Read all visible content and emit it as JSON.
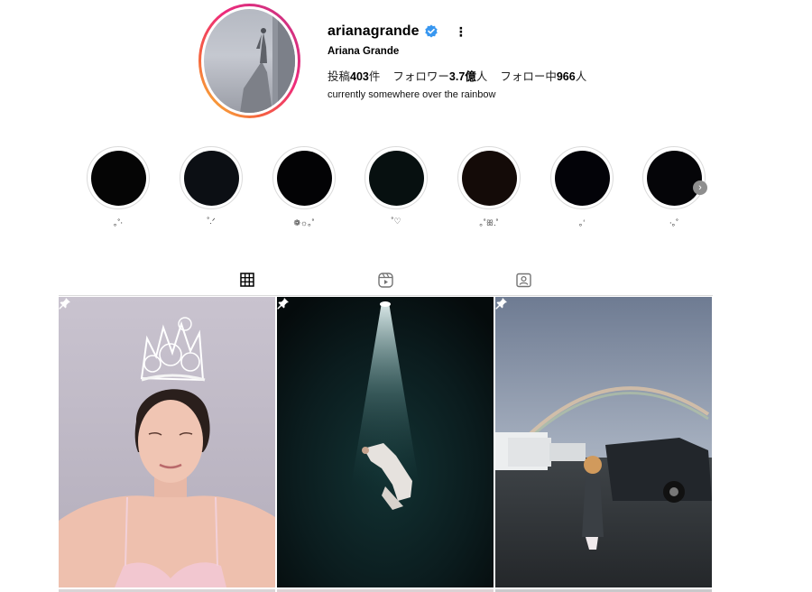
{
  "profile": {
    "username": "arianagrande",
    "full_name": "Ariana Grande",
    "more_label": "⋮",
    "stats": {
      "posts_label": "投稿",
      "posts_value": "403",
      "posts_unit": "件",
      "followers_label": "フォロワー",
      "followers_value": "3.7億",
      "followers_unit": "人",
      "following_label": "フォロー中",
      "following_value": "966",
      "following_unit": "人"
    },
    "bio": "currently somewhere over the rainbow"
  },
  "highlights": [
    {
      "label": "｡˚‧",
      "color": "#050505"
    },
    {
      "label": "˚.ᐟ",
      "color": "#0c0f14"
    },
    {
      "label": "❁☼｡˚",
      "color": "#030305"
    },
    {
      "label": "˚♡",
      "color": "#071010"
    },
    {
      "label": "｡˚ꕥ.˚",
      "color": "#140b08"
    },
    {
      "label": "｡ʻ",
      "color": "#030308"
    },
    {
      "label": "‧｡˚",
      "color": "#050508"
    }
  ],
  "tabs": [
    "grid",
    "reels",
    "tagged"
  ],
  "posts": [
    {
      "pinned": true,
      "subject": "crown selfie"
    },
    {
      "pinned": true,
      "subject": "spotlight"
    },
    {
      "pinned": true,
      "subject": "rainbow"
    }
  ],
  "colors": {
    "verified": "#3897f0",
    "ring_start": "#f9ce34",
    "ring_end": "#c13584",
    "divider": "#dbdbdb"
  }
}
